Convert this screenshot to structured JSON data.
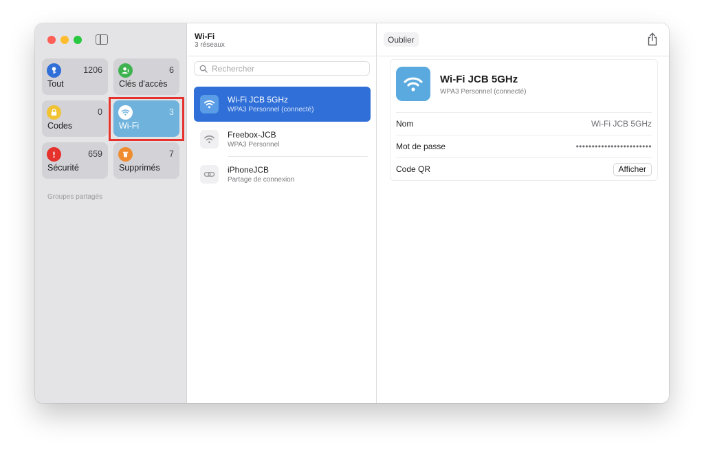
{
  "sidebar": {
    "tiles": [
      {
        "label": "Tout",
        "count": "1206",
        "icon": "key-icon",
        "color": "#2f6fd7"
      },
      {
        "label": "Clés d'accès",
        "count": "6",
        "icon": "person-key-icon",
        "color": "#3fb250"
      },
      {
        "label": "Codes",
        "count": "0",
        "icon": "lock-clock-icon",
        "color": "#f1c232"
      },
      {
        "label": "Wi-Fi",
        "count": "3",
        "icon": "wifi-icon",
        "color": "#6fb3dd"
      },
      {
        "label": "Sécurité",
        "count": "659",
        "icon": "exclamation-icon",
        "color": "#e5322d"
      },
      {
        "label": "Supprimés",
        "count": "7",
        "icon": "trash-icon",
        "color": "#f08c30"
      }
    ],
    "groups_label": "Groupes partagés"
  },
  "list": {
    "title": "Wi-Fi",
    "subtitle": "3 réseaux",
    "search_placeholder": "Rechercher",
    "networks": [
      {
        "name": "Wi-Fi JCB 5GHz",
        "detail": "WPA3 Personnel (connecté)",
        "icon": "wifi-icon",
        "selected": true
      },
      {
        "name": "Freebox-JCB",
        "detail": "WPA3 Personnel",
        "icon": "wifi-icon",
        "selected": false
      },
      {
        "name": "iPhoneJCB",
        "detail": "Partage de connexion",
        "icon": "link-icon",
        "selected": false
      }
    ]
  },
  "detail": {
    "forget_label": "Oublier",
    "title": "Wi-Fi JCB 5GHz",
    "subtitle": "WPA3 Personnel (connecté)",
    "name_label": "Nom",
    "name_value": "Wi-Fi JCB 5GHz",
    "password_label": "Mot de passe",
    "password_value": "••••••••••••••••••••••••",
    "qr_label": "Code QR",
    "show_label": "Afficher"
  }
}
